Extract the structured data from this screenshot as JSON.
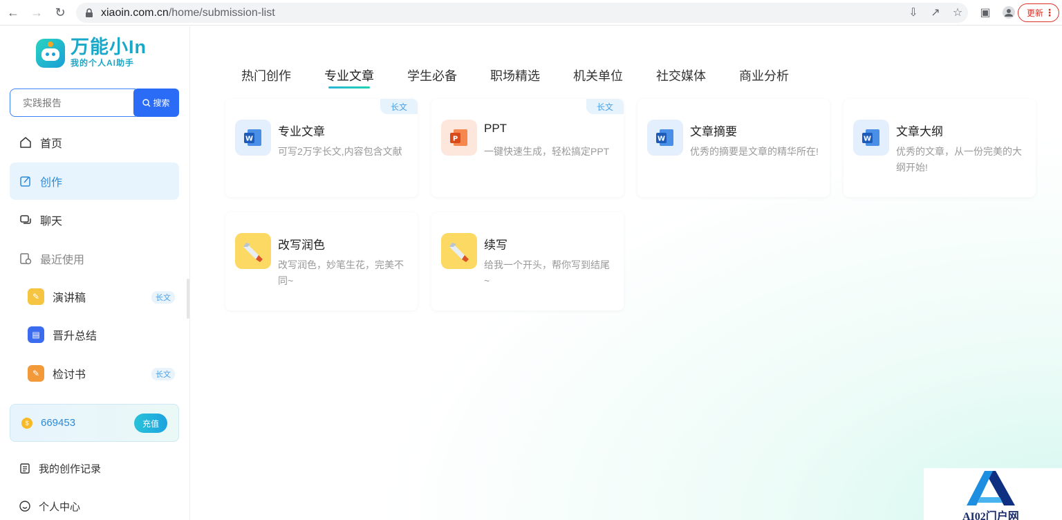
{
  "browser": {
    "url_host": "xiaoin.com.cn",
    "url_path": "/home/submission-list",
    "update_label": "更新"
  },
  "sidebar": {
    "logo_title": "万能小In",
    "logo_subtitle": "我的个人AI助手",
    "search_placeholder": "实践报告",
    "search_button": "搜索",
    "menu": {
      "home": "首页",
      "create": "创作",
      "chat": "聊天",
      "recent": "最近使用"
    },
    "recent_items": [
      {
        "label": "演讲稿",
        "tag": "长文",
        "color": "#f5c542"
      },
      {
        "label": "晋升总结",
        "tag": "",
        "color": "#3b6cf0"
      },
      {
        "label": "检讨书",
        "tag": "长文",
        "color": "#f29a3a"
      }
    ],
    "coins": "669453",
    "recharge": "充值",
    "records": "我的创作记录",
    "profile": "个人中心"
  },
  "tabs": [
    "热门创作",
    "专业文章",
    "学生必备",
    "职场精选",
    "机关单位",
    "社交媒体",
    "商业分析"
  ],
  "active_tab": 1,
  "cards": [
    {
      "title": "专业文章",
      "desc": "可写2万字长文,内容包含文献",
      "tag": "长文",
      "icon": "word-icon"
    },
    {
      "title": "PPT",
      "desc": "一键快速生成，轻松搞定PPT",
      "tag": "长文",
      "icon": "ppt-icon"
    },
    {
      "title": "文章摘要",
      "desc": "优秀的摘要是文章的精华所在!",
      "tag": "",
      "icon": "word-icon"
    },
    {
      "title": "文章大纲",
      "desc": "优秀的文章，从一份完美的大纲开始!",
      "tag": "",
      "icon": "word-icon"
    },
    {
      "title": "改写润色",
      "desc": "改写润色，妙笔生花，完美不同~",
      "tag": "",
      "icon": "pen-icon"
    },
    {
      "title": "续写",
      "desc": "给我一个开头，帮你写到结尾~",
      "tag": "",
      "icon": "pen-icon"
    }
  ],
  "watermark": "AI02门户网"
}
